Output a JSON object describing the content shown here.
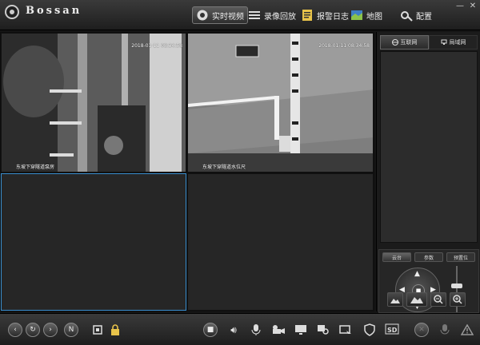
{
  "app": {
    "brand": "Bossan"
  },
  "nav": [
    {
      "label": "实时视频",
      "icon": "camera-icon",
      "active": true
    },
    {
      "label": "录像回放",
      "icon": "playback-icon",
      "active": false
    },
    {
      "label": "报警日志",
      "icon": "alarm-log-icon",
      "active": false
    },
    {
      "label": "地图",
      "icon": "map-icon",
      "active": false
    },
    {
      "label": "配置",
      "icon": "config-icon",
      "active": false
    }
  ],
  "window_buttons": {
    "minimize": "—",
    "close": "✕"
  },
  "cameras": [
    {
      "timestamp": "2018-01-11 08:34:58",
      "name": "东坡下穿隧道泵房"
    },
    {
      "timestamp": "2018-01-11 08:34:58",
      "name": "东坡下穿隧道水位尺"
    }
  ],
  "right_panel": {
    "tabs": [
      {
        "label": "互联网",
        "icon": "globe-icon",
        "active": true
      },
      {
        "label": "局域网",
        "icon": "lan-icon",
        "active": false
      }
    ]
  },
  "ptz": {
    "tabs": [
      {
        "label": "云台",
        "active": true
      },
      {
        "label": "参数",
        "active": false
      },
      {
        "label": "预置位",
        "active": false
      }
    ]
  }
}
